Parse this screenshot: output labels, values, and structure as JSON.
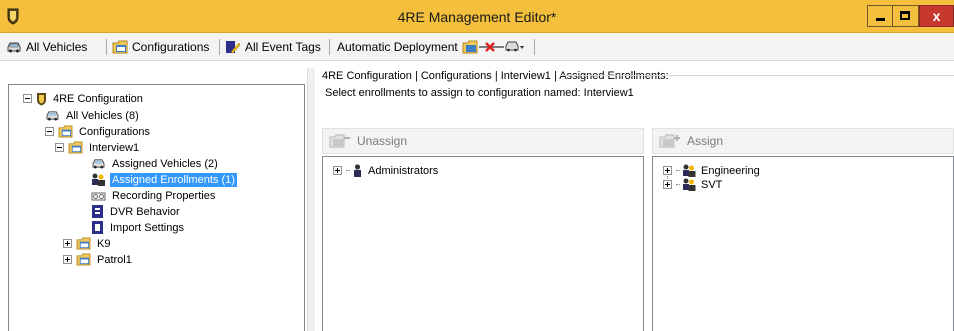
{
  "window": {
    "title": "4RE Management Editor*"
  },
  "toolbar": {
    "all_vehicles": "All Vehicles",
    "configurations": "Configurations",
    "all_event_tags": "All Event Tags",
    "automatic_deployment": "Automatic Deployment"
  },
  "tree": {
    "root": "4RE Configuration",
    "all_vehicles": "All Vehicles (8)",
    "configurations": "Configurations",
    "interview1": "Interview1",
    "assigned_vehicles": "Assigned Vehicles (2)",
    "assigned_enrollments": "Assigned Enrollments (1)",
    "recording_properties": "Recording Properties",
    "dvr_behavior": "DVR Behavior",
    "import_settings": "Import Settings",
    "k9": "K9",
    "patrol1": "Patrol1"
  },
  "content": {
    "breadcrumb": "4RE Configuration  |  Configurations  |  Interview1  |  Assigned Enrollments:",
    "instruction": "Select enrollments to assign to configuration named: Interview1",
    "unassign_label": "Unassign",
    "assign_label": "Assign",
    "assigned_list": [
      "Administrators"
    ],
    "available_list": [
      "Engineering",
      "SVT"
    ]
  },
  "colors": {
    "titlebar": "#f3bf3d",
    "selection": "#3399ff",
    "close": "#c7382f"
  }
}
